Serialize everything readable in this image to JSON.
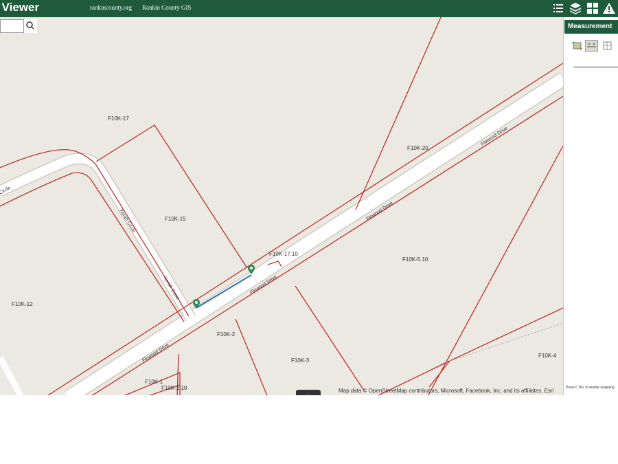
{
  "header": {
    "title": "ap Viewer",
    "link_county": "rankincounty.org",
    "link_gis": "Rankin County GIS"
  },
  "search": {
    "value": "",
    "placeholder": ""
  },
  "map": {
    "parcels": [
      "F10K-17",
      "F10K-20",
      "F10K-15",
      "F10K-17.10",
      "F10K-5.10",
      "F10K-12",
      "F10K-2",
      "F10K-3",
      "F10K-4",
      "F10K-1",
      "F10K-1.10"
    ],
    "roads": {
      "flowood": "Flowood Drive",
      "kerah": "Kerah Circle",
      "circle": "Circle"
    },
    "attribution": "Map data © OpenStreetMap contributors, Microsoft, Facebook, Inc. and its affiliates, Esri",
    "ctrl_hint": "Press CTRL to enable snapping"
  },
  "panel": {
    "title": "Measurement"
  },
  "colors": {
    "header": "#1f5a3a",
    "parcel_line": "#b9332f",
    "road": "#ffffff",
    "measure_line": "#2f6fb8",
    "map_bg": "#ece8e2"
  },
  "icons": [
    "list-icon",
    "layers-icon",
    "grid-icon",
    "warning-icon",
    "search-icon",
    "area-icon",
    "distance-icon",
    "location-icon",
    "map-pin-icon"
  ]
}
